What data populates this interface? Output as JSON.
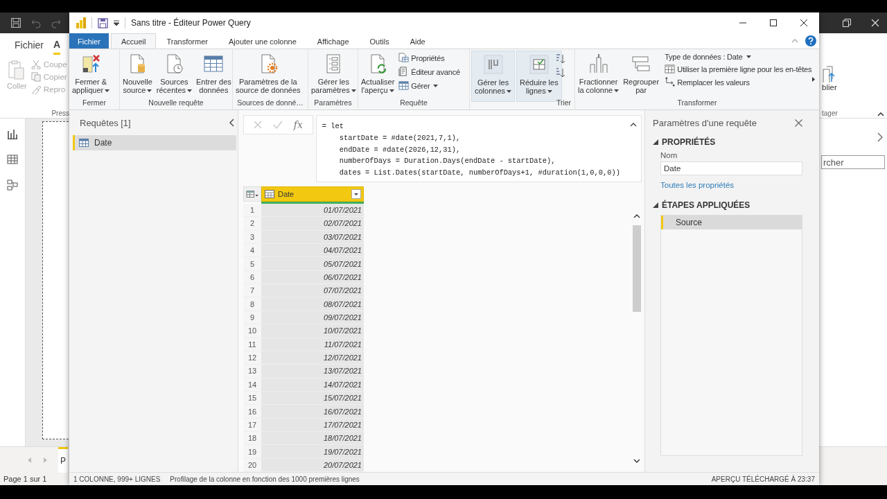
{
  "background_app": {
    "menu": [
      {
        "label": "Fichier",
        "selected": false
      },
      {
        "label": "A",
        "selected": true
      }
    ],
    "clipboard": {
      "paste": {
        "label": "Coller",
        "disabled": true
      },
      "actions": [
        {
          "label": "Coupe",
          "disabled": true
        },
        {
          "label": "Copier",
          "disabled": true
        },
        {
          "label": "Repro",
          "disabled": true
        }
      ],
      "group_label": "Press"
    },
    "share": {
      "button": "blier",
      "group_label": "tager"
    },
    "search": {
      "placeholder": "rcher"
    },
    "page_tabs": [
      {
        "label": "P",
        "selected": true
      }
    ],
    "status": "Page 1 sur 1"
  },
  "window": {
    "title": "Sans titre - Éditeur Power Query",
    "tabs": [
      {
        "label": "Fichier",
        "kind": "file",
        "selected": false
      },
      {
        "label": "Accueil",
        "kind": "tab",
        "selected": true
      },
      {
        "label": "Transformer",
        "kind": "tab",
        "selected": false
      },
      {
        "label": "Ajouter une colonne",
        "kind": "tab",
        "selected": false
      },
      {
        "label": "Affichage",
        "kind": "tab",
        "selected": false
      },
      {
        "label": "Outils",
        "kind": "tab",
        "selected": false
      },
      {
        "label": "Aide",
        "kind": "tab",
        "selected": false
      }
    ],
    "ribbon": {
      "groups": [
        {
          "label": "Fermer",
          "buttons": [
            {
              "kind": "large",
              "lines": [
                "Fermer &",
                "appliquer"
              ],
              "dropdown": true,
              "highlighted": false
            }
          ]
        },
        {
          "label": "Nouvelle requête",
          "buttons": [
            {
              "kind": "large",
              "lines": [
                "Nouvelle",
                "source"
              ],
              "dropdown": true,
              "highlighted": false
            },
            {
              "kind": "large",
              "lines": [
                "Sources",
                "récentes"
              ],
              "dropdown": true,
              "highlighted": false
            },
            {
              "kind": "large",
              "lines": [
                "Entrer des",
                "données"
              ],
              "dropdown": false,
              "highlighted": false
            }
          ]
        },
        {
          "label": "Sources de donné…",
          "buttons": [
            {
              "kind": "large",
              "lines": [
                "Paramètres de la",
                "source de données"
              ],
              "dropdown": false,
              "highlighted": false
            }
          ]
        },
        {
          "label": "Paramètres",
          "buttons": [
            {
              "kind": "large",
              "lines": [
                "Gérer les",
                "paramètres"
              ],
              "dropdown": true,
              "highlighted": false
            }
          ]
        },
        {
          "label": "Requête",
          "buttons": [
            {
              "kind": "large",
              "lines": [
                "Actualiser",
                "l'aperçu"
              ],
              "dropdown": true,
              "highlighted": false
            },
            {
              "kind": "small",
              "label": "Propriétés",
              "dropdown": false
            },
            {
              "kind": "small",
              "label": "Éditeur avancé",
              "dropdown": false
            },
            {
              "kind": "small",
              "label": "Gérer",
              "dropdown": true
            }
          ]
        },
        {
          "buttons": [
            {
              "kind": "large",
              "lines": [
                "Gérer les",
                "colonnes"
              ],
              "dropdown": true,
              "highlighted": true
            },
            {
              "kind": "large",
              "lines": [
                "Réduire les",
                "lignes"
              ],
              "dropdown": true,
              "highlighted": true
            }
          ]
        },
        {
          "label": "Trier",
          "buttons": [
            {
              "kind": "icon"
            },
            {
              "kind": "icon"
            }
          ]
        },
        {
          "label": "Transformer",
          "buttons": [
            {
              "kind": "large",
              "lines": [
                "Fractionner",
                "la colonne"
              ],
              "dropdown": true,
              "highlighted": false
            },
            {
              "kind": "large",
              "lines": [
                "Regrouper",
                "par"
              ],
              "dropdown": false,
              "highlighted": false
            },
            {
              "kind": "small",
              "label": "Type de données : Date",
              "dropdown": true
            },
            {
              "kind": "small",
              "label": "Utiliser la première ligne pour les en-têtes",
              "dropdown": false
            },
            {
              "kind": "small",
              "label": "Remplacer les valeurs",
              "dropdown": false
            }
          ]
        }
      ]
    },
    "queries": {
      "title": "Requêtes [1]",
      "items": [
        {
          "label": "Date",
          "selected": true
        }
      ]
    },
    "formula": {
      "function_label": "fx",
      "text": "= let\n    startDate = #date(2021,7,1),\n    endDate = #date(2026,12,31),\n    numberOfDays = Duration.Days(endDate - startDate),\n    dates = List.Dates(startDate, numberOfDays+1, #duration(1,0,0,0))"
    },
    "grid": {
      "columns": [
        {
          "label": "Date",
          "selected": true
        }
      ],
      "rows": [
        {
          "number": "1",
          "cells": [
            "01/07/2021"
          ]
        },
        {
          "number": "2",
          "cells": [
            "02/07/2021"
          ]
        },
        {
          "number": "3",
          "cells": [
            "03/07/2021"
          ]
        },
        {
          "number": "4",
          "cells": [
            "04/07/2021"
          ]
        },
        {
          "number": "5",
          "cells": [
            "05/07/2021"
          ]
        },
        {
          "number": "6",
          "cells": [
            "06/07/2021"
          ]
        },
        {
          "number": "7",
          "cells": [
            "07/07/2021"
          ]
        },
        {
          "number": "8",
          "cells": [
            "08/07/2021"
          ]
        },
        {
          "number": "9",
          "cells": [
            "09/07/2021"
          ]
        },
        {
          "number": "10",
          "cells": [
            "10/07/2021"
          ]
        },
        {
          "number": "11",
          "cells": [
            "11/07/2021"
          ]
        },
        {
          "number": "12",
          "cells": [
            "12/07/2021"
          ]
        },
        {
          "number": "13",
          "cells": [
            "13/07/2021"
          ]
        },
        {
          "number": "14",
          "cells": [
            "14/07/2021"
          ]
        },
        {
          "number": "15",
          "cells": [
            "15/07/2021"
          ]
        },
        {
          "number": "16",
          "cells": [
            "16/07/2021"
          ]
        },
        {
          "number": "17",
          "cells": [
            "17/07/2021"
          ]
        },
        {
          "number": "18",
          "cells": [
            "18/07/2021"
          ]
        },
        {
          "number": "19",
          "cells": [
            "19/07/2021"
          ]
        },
        {
          "number": "20",
          "cells": [
            "20/07/2021"
          ]
        }
      ]
    },
    "settings": {
      "title": "Paramètres d'une requête",
      "properties": {
        "heading": "PROPRIÉTÉS",
        "expanded": true,
        "name_label": "Nom",
        "name_value": "Date",
        "link": "Toutes les propriétés"
      },
      "steps": {
        "heading": "ÉTAPES APPLIQUÉES",
        "expanded": true,
        "items": [
          {
            "label": "Source",
            "selected": true
          }
        ]
      }
    },
    "status_bar": {
      "left": [
        "1 COLONNE, 999+ LIGNES",
        "Profilage de la colonne en fonction des 1000 premières lignes"
      ],
      "right": "APERÇU TÉLÉCHARGÉ À 23:37"
    }
  }
}
